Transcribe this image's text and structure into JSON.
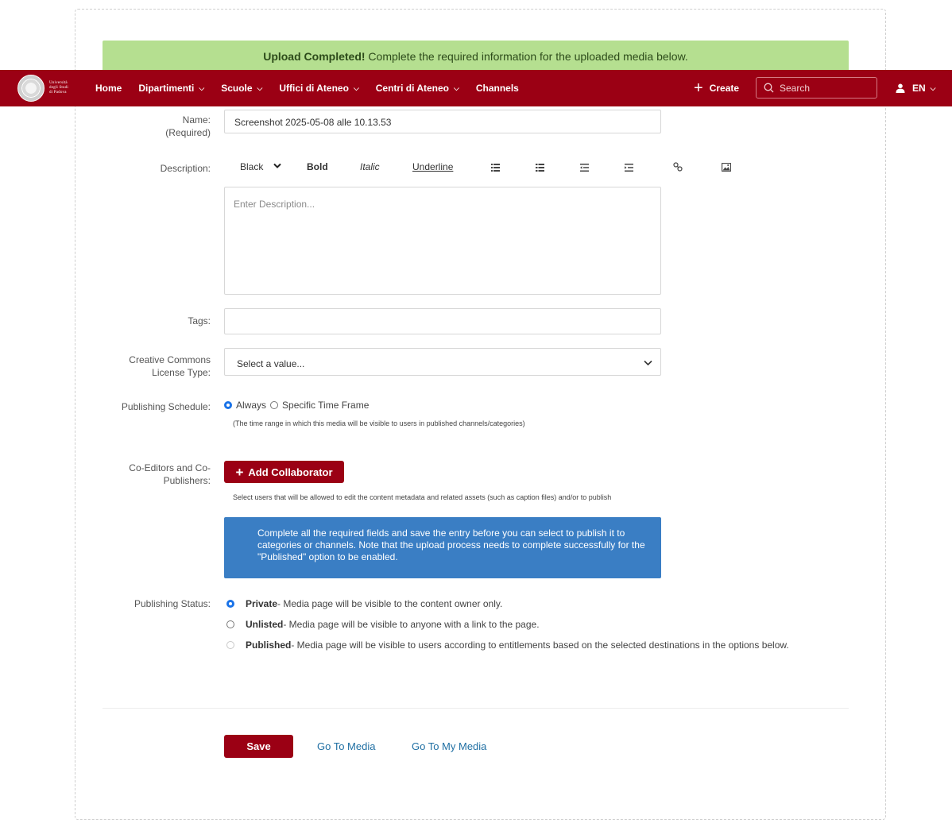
{
  "banner": {
    "strong": "Upload Completed!",
    "text": " Complete the required information for the uploaded media below."
  },
  "nav": {
    "logo_text": [
      "Università",
      "degli Studi",
      "di Padova"
    ],
    "items": [
      {
        "label": "Home",
        "dropdown": false
      },
      {
        "label": "Dipartimenti",
        "dropdown": true
      },
      {
        "label": "Scuole",
        "dropdown": true
      },
      {
        "label": "Uffici di Ateneo",
        "dropdown": true
      },
      {
        "label": "Centri di Ateneo",
        "dropdown": true
      },
      {
        "label": "Channels",
        "dropdown": false
      }
    ],
    "create": "Create",
    "search_placeholder": "Search",
    "language": "EN"
  },
  "form": {
    "name_label": "Name:",
    "name_required": "(Required)",
    "name_value": "Screenshot 2025-05-08 alle 10.13.53",
    "description_label": "Description:",
    "toolbar": {
      "color": "Black",
      "bold": "Bold",
      "italic": "Italic",
      "underline": "Underline"
    },
    "description_placeholder": "Enter Description...",
    "tags_label": "Tags:",
    "cc_label_1": "Creative Commons",
    "cc_label_2": "License Type:",
    "cc_value": "Select a value...",
    "schedule_label": "Publishing Schedule:",
    "schedule_always": "Always",
    "schedule_specific": "Specific Time Frame",
    "schedule_help": "(The time range in which this media will be visible to users in published channels/categories)",
    "coeditors_label_1": "Co-Editors and Co-",
    "coeditors_label_2": "Publishers:",
    "add_collaborator": "Add Collaborator",
    "coeditors_help": "Select users that will be allowed to edit the content metadata and related assets (such as caption files) and/or to publish",
    "info_text": "Complete all the required fields and save the entry before you can select to publish it to categories or channels. Note that the upload process needs to complete successfully for the \"Published\" option to be enabled.",
    "status_label": "Publishing Status:",
    "status": [
      {
        "title": "Private",
        "text": " - Media page will be visible to the content owner only.",
        "selected": true,
        "disabled": false
      },
      {
        "title": "Unlisted",
        "text": " - Media page will be visible to anyone with a link to the page.",
        "selected": false,
        "disabled": false
      },
      {
        "title": "Published",
        "text": " - Media page will be visible to users according to entitlements based on the selected destinations in the options below.",
        "selected": false,
        "disabled": true
      }
    ]
  },
  "actions": {
    "save": "Save",
    "go_to_media": "Go To Media",
    "go_to_my_media": "Go To My Media"
  },
  "colors": {
    "brand": "#9b0014",
    "banner": "#b5df90",
    "info": "#3a7ec4",
    "link": "#1f6fa3",
    "radio": "#1a73e8"
  }
}
